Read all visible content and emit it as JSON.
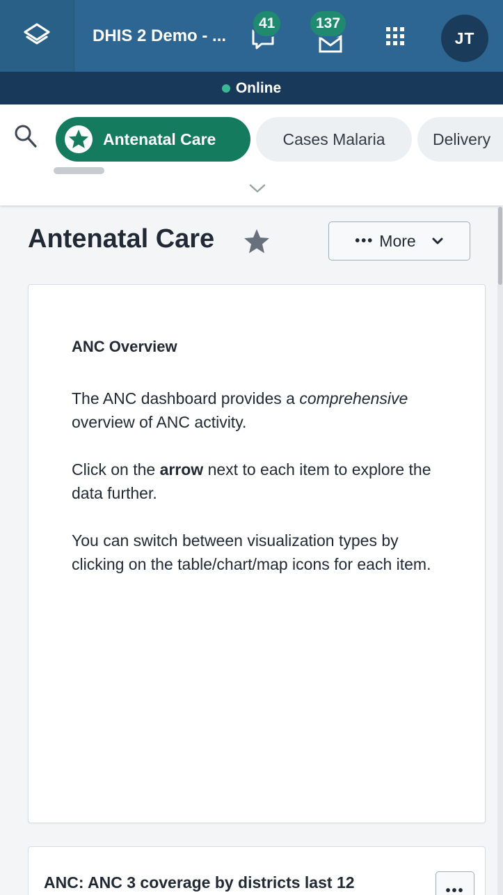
{
  "header": {
    "app_title": "DHIS 2 Demo - ...",
    "messages_badge": "41",
    "interpretations_badge": "137",
    "user_initials": "JT"
  },
  "status": {
    "online_label": "Online"
  },
  "chips": [
    {
      "label": "Antenatal Care",
      "active": true,
      "starred": true
    },
    {
      "label": "Cases Malaria",
      "active": false
    },
    {
      "label": "Delivery",
      "active": false
    }
  ],
  "dashboard": {
    "title": "Antenatal Care",
    "more_label": "More"
  },
  "text_card": {
    "heading": "ANC Overview",
    "p1_text_a": "The ANC dashboard provides a ",
    "p1_emph": "comprehensive",
    "p1_text_b": " overview of ANC activity.",
    "p2_text_a": "Click on the ",
    "p2_bold": "arrow",
    "p2_text_b": " next to each item to explore the data further.",
    "p3": "You can switch between visualization types by clicking on the table/chart/map icons for each item."
  },
  "next_card": {
    "title": "ANC: ANC 3 coverage by districts last 12"
  },
  "colors": {
    "header_bg": "#2d6693",
    "status_bg": "#18395a",
    "accent_green": "#147b5f",
    "online_dot": "#3ab795"
  }
}
